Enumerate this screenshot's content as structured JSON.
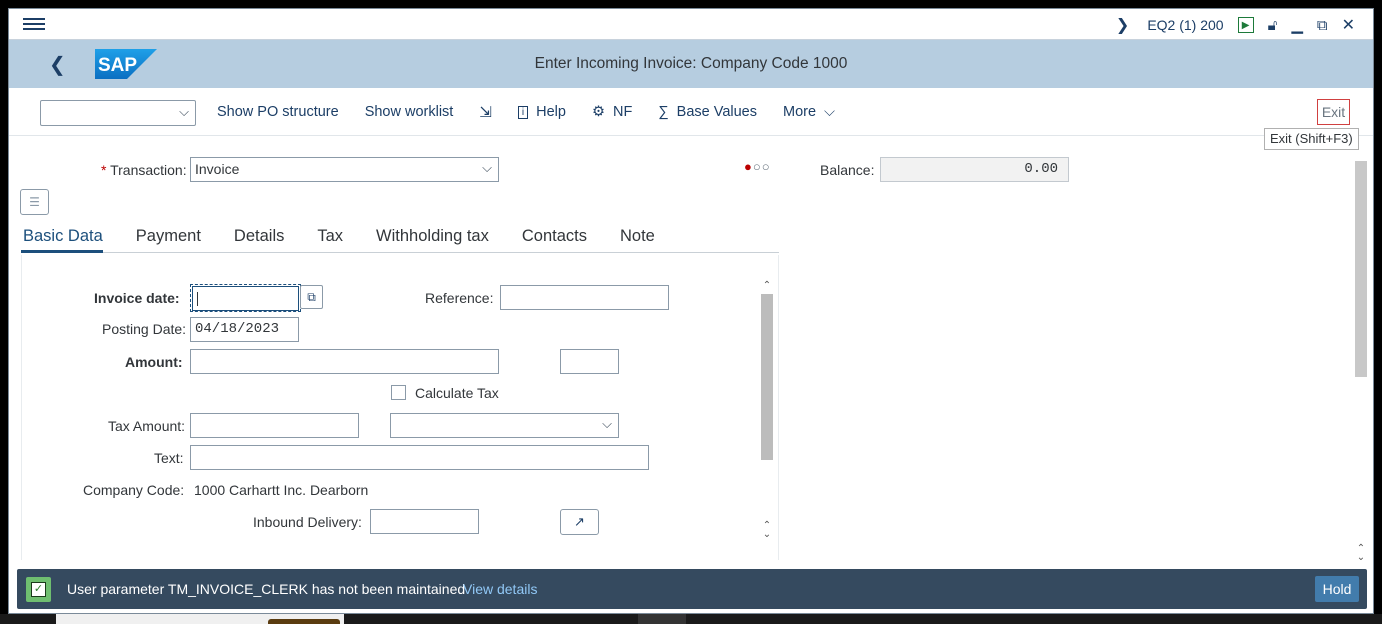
{
  "titlebar": {
    "system": "EQ2 (1) 200"
  },
  "header": {
    "logo_text": "SAP",
    "title": "Enter Incoming Invoice: Company Code 1000"
  },
  "toolbar": {
    "select_value": "",
    "items": [
      "Show PO structure",
      "Show worklist",
      "Help",
      "NF",
      "Base Values",
      "More"
    ],
    "exit_label": "Exit"
  },
  "tooltip": "Exit   (Shift+F3)",
  "form": {
    "transaction_label": "Transaction:",
    "transaction_value": "Invoice",
    "balance_label": "Balance:",
    "balance_value": "0.00"
  },
  "tabs": [
    "Basic Data",
    "Payment",
    "Details",
    "Tax",
    "Withholding tax",
    "Contacts",
    "Note"
  ],
  "basic_data": {
    "invoice_date_label": "Invoice date:",
    "invoice_date_value": "",
    "reference_label": "Reference:",
    "reference_value": "",
    "posting_date_label": "Posting Date:",
    "posting_date_value": "04/18/2023",
    "amount_label": "Amount:",
    "amount_value": "",
    "currency_value": "",
    "calculate_tax_label": "Calculate Tax",
    "tax_amount_label": "Tax Amount:",
    "tax_amount_value": "",
    "tax_code_value": "",
    "text_label": "Text:",
    "text_value": "",
    "company_code_label": "Company Code:",
    "company_code_value": "1000 Carhartt Inc. Dearborn",
    "inbound_delivery_label": "Inbound Delivery:",
    "inbound_delivery_value": ""
  },
  "message_bar": {
    "text": "User parameter TM_INVOICE_CLERK  has not been maintained",
    "link": "View details",
    "hold_label": "Hold"
  },
  "colors": {
    "header_bg": "#b6cde0",
    "message_bg": "#354a5f",
    "accent": "#1c4f7c",
    "required": "#bb0000"
  }
}
